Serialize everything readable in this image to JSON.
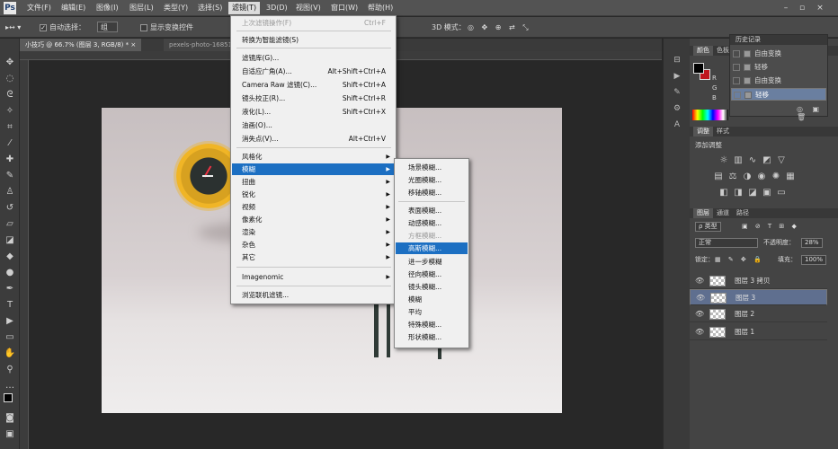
{
  "menubar": {
    "logo": "Ps",
    "items": [
      "文件(F)",
      "编辑(E)",
      "图像(I)",
      "图层(L)",
      "类型(Y)",
      "选择(S)",
      "滤镜(T)",
      "3D(D)",
      "视图(V)",
      "窗口(W)",
      "帮助(H)"
    ],
    "active_index": 6
  },
  "options_bar": {
    "auto_select_label": "自动选择：",
    "auto_select_value": "组",
    "show_transform_label": "显示变换控件",
    "mode_label": "3D 模式："
  },
  "doc_tabs": [
    {
      "label": "小技巧 @ 66.7% (图层 3, RGB/8) * ×"
    },
    {
      "label": "pexels-photo-168512..."
    }
  ],
  "filter_menu": {
    "items": [
      {
        "label": "上次滤镜操作(F)",
        "shortcut": "Ctrl+F",
        "disabled": true
      },
      {
        "label": "转换为智能滤镜(S)",
        "shortcut": ""
      },
      {
        "label": "滤镜库(G)...",
        "shortcut": ""
      },
      {
        "label": "自适应广角(A)...",
        "shortcut": "Alt+Shift+Ctrl+A"
      },
      {
        "label": "Camera Raw 滤镜(C)...",
        "shortcut": "Shift+Ctrl+A"
      },
      {
        "label": "镜头校正(R)...",
        "shortcut": "Shift+Ctrl+R"
      },
      {
        "label": "液化(L)...",
        "shortcut": "Shift+Ctrl+X"
      },
      {
        "label": "油画(O)...",
        "shortcut": ""
      },
      {
        "label": "消失点(V)...",
        "shortcut": "Alt+Ctrl+V"
      },
      {
        "label": "风格化",
        "submenu": true
      },
      {
        "label": "模糊",
        "submenu": true,
        "highlighted": true
      },
      {
        "label": "扭曲",
        "submenu": true
      },
      {
        "label": "锐化",
        "submenu": true
      },
      {
        "label": "视频",
        "submenu": true
      },
      {
        "label": "像素化",
        "submenu": true
      },
      {
        "label": "渲染",
        "submenu": true
      },
      {
        "label": "杂色",
        "submenu": true
      },
      {
        "label": "其它",
        "submenu": true
      },
      {
        "label": "Imagenomic",
        "submenu": true
      },
      {
        "label": "浏览联机滤镜..."
      }
    ]
  },
  "blur_submenu": {
    "items": [
      {
        "label": "场景模糊..."
      },
      {
        "label": "光圈模糊..."
      },
      {
        "label": "移轴模糊..."
      },
      {
        "label": "表面模糊..."
      },
      {
        "label": "动感模糊..."
      },
      {
        "label": "方框模糊...",
        "faded": true
      },
      {
        "label": "高斯模糊...",
        "highlighted": true
      },
      {
        "label": "进一步模糊"
      },
      {
        "label": "径向模糊..."
      },
      {
        "label": "镜头模糊..."
      },
      {
        "label": "模糊"
      },
      {
        "label": "平均"
      },
      {
        "label": "特殊模糊..."
      },
      {
        "label": "形状模糊..."
      }
    ]
  },
  "panels": {
    "color_tabs": [
      "颜色",
      "色板"
    ],
    "history_title": "历史记录",
    "history": [
      {
        "label": "自由变换"
      },
      {
        "label": "轻移"
      },
      {
        "label": "自由变换"
      },
      {
        "label": "轻移",
        "selected": true
      }
    ],
    "rgb_labels": [
      "R",
      "G",
      "B"
    ],
    "adjust_tabs": [
      "调整",
      "样式"
    ],
    "adjust_title": "添加调整",
    "layers_tabs": [
      "图层",
      "通道",
      "路径"
    ],
    "kind_label": "ρ 类型",
    "blend_mode": "正常",
    "opacity_label": "不透明度：",
    "opacity_value": "28%",
    "lock_label": "锁定：",
    "fill_label": "填充：",
    "fill_value": "100%",
    "layers": [
      {
        "name": "图层 3 拷贝"
      },
      {
        "name": "图层 3",
        "selected": true
      },
      {
        "name": "图层 2"
      },
      {
        "name": "图层 1"
      }
    ]
  },
  "colors": {
    "foreground": "#000000",
    "background": "#c0161e",
    "menu_highlight": "#1c6fc2"
  }
}
